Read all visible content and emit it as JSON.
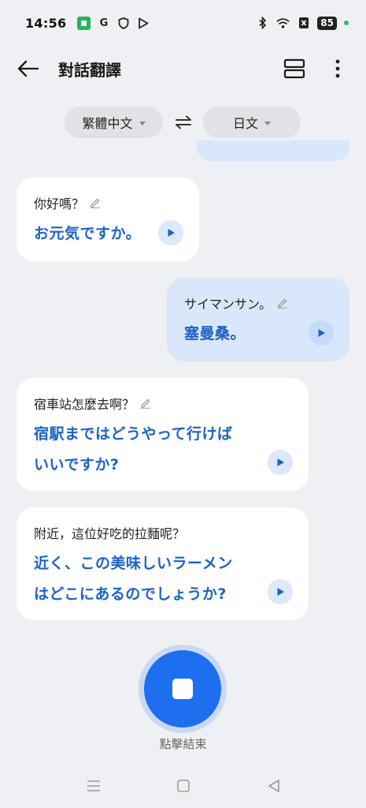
{
  "status_bar": {
    "time": "14:56",
    "left_icons": [
      "app-badge-icon",
      "google-icon",
      "shield-icon",
      "play-store-icon"
    ],
    "google_letter": "G",
    "battery": "85"
  },
  "app_bar": {
    "title": "對話翻譯"
  },
  "languages": {
    "source": "繁體中文",
    "target": "日文"
  },
  "messages": [
    {
      "side": "left",
      "source": "你好嗎？",
      "translation_lines": [
        "お元気ですか。"
      ]
    },
    {
      "side": "right",
      "source": "サイマンサン。",
      "translation_lines": [
        "塞曼桑。"
      ]
    },
    {
      "side": "left",
      "source": "宿車站怎麼去啊？",
      "translation_lines": [
        "宿駅まではどうやって行けば",
        "いいですか?"
      ]
    },
    {
      "side": "left",
      "source": "附近，這位好吃的拉麵呢？",
      "translation_lines": [
        "近く、この美味しいラーメン",
        "はどこにあるのでしょうか?"
      ]
    }
  ],
  "stop": {
    "label": "點擊結束"
  },
  "colors": {
    "accent": "#1e6ff0",
    "translation_text": "#1c63c7",
    "right_bubble": "#d9e7fb",
    "background": "#eff0f3"
  }
}
